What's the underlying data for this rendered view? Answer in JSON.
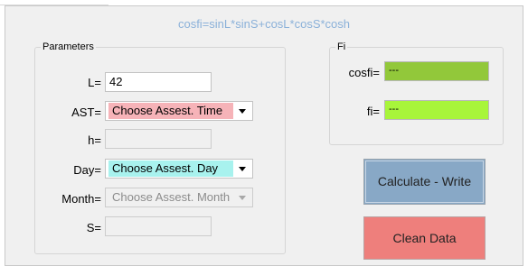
{
  "window": {
    "formula_title": "cosfi=sinL*sinS+cosL*cosS*cosh"
  },
  "parameters": {
    "legend": "Parameters",
    "L": {
      "label": "L=",
      "value": "42"
    },
    "AST": {
      "label": "AST=",
      "selected": "Choose Assest. Time",
      "highlight": "#f6b3b8"
    },
    "h": {
      "label": "h=",
      "value": ""
    },
    "Day": {
      "label": "Day=",
      "selected": "Choose Assest. Day",
      "highlight": "#a8f2ee"
    },
    "Month": {
      "label": "Month=",
      "selected": "Choose Assest. Month"
    },
    "S": {
      "label": "S=",
      "value": ""
    }
  },
  "fi_group": {
    "legend": "Fi",
    "cosfi": {
      "label": "cosfi=",
      "value": "---",
      "color": "#92c83a"
    },
    "fi": {
      "label": "fi=",
      "value": "---",
      "color": "#a8f53b"
    }
  },
  "buttons": {
    "calculate": "Calculate - Write",
    "clean": "Clean Data"
  },
  "icons": {
    "combo_arrow": "chevron-down-icon"
  }
}
